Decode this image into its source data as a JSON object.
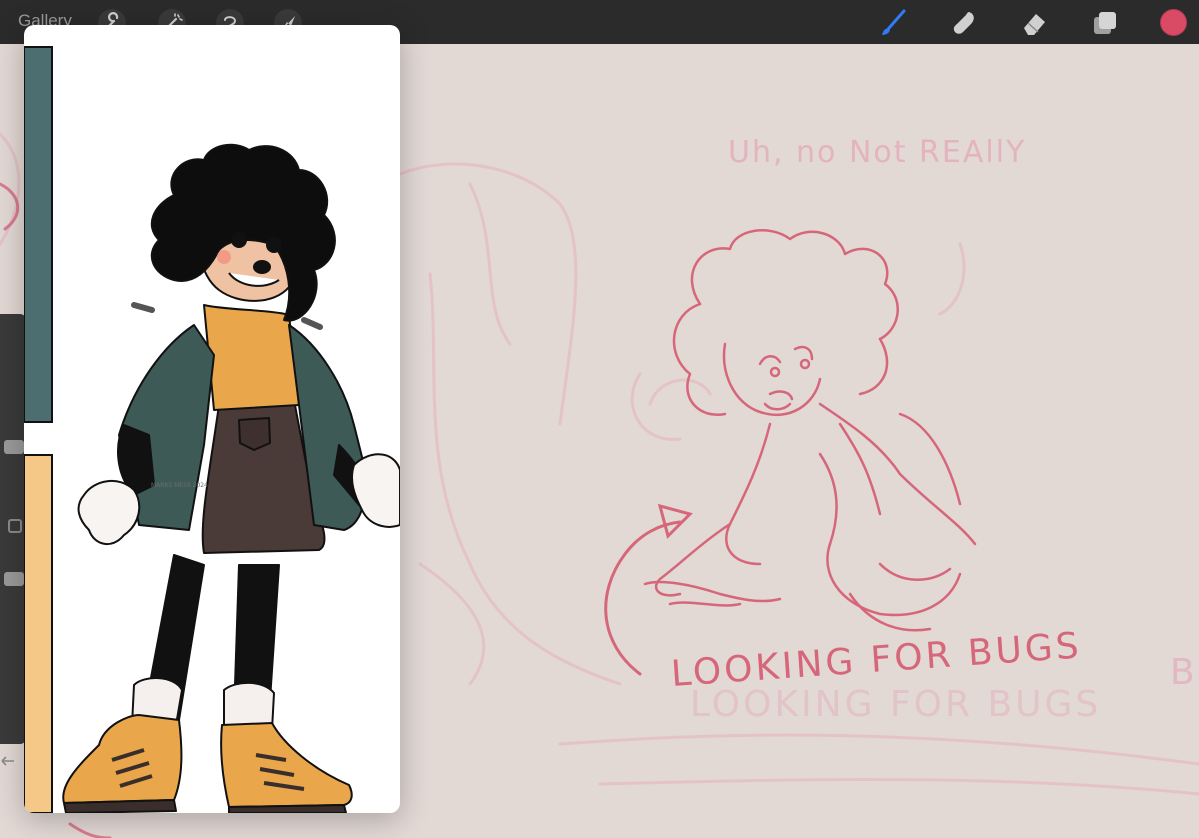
{
  "toolbar": {
    "gallery_label": "Gallery",
    "left_tools": [
      "wrench-icon",
      "magic-wand-icon",
      "selection-icon",
      "transform-arrow-icon"
    ],
    "right_tools": [
      "brush-icon",
      "smudge-icon",
      "eraser-icon",
      "layers-icon"
    ],
    "current_color": "#d94a64"
  },
  "canvas": {
    "background_color": "#e2d8d4",
    "stroke_color": "#d6677a",
    "sketch_text_top": "Uh, no Not REAllY",
    "sketch_text_bottom": "LOOKING FOR BUGS",
    "sketch_text_ghost": "LOOKING FOR BUGS"
  },
  "reference": {
    "swatch_teal": "#4c6e70",
    "swatch_yellow": "#f6c887",
    "signature": "MARKS MESS 2024"
  }
}
